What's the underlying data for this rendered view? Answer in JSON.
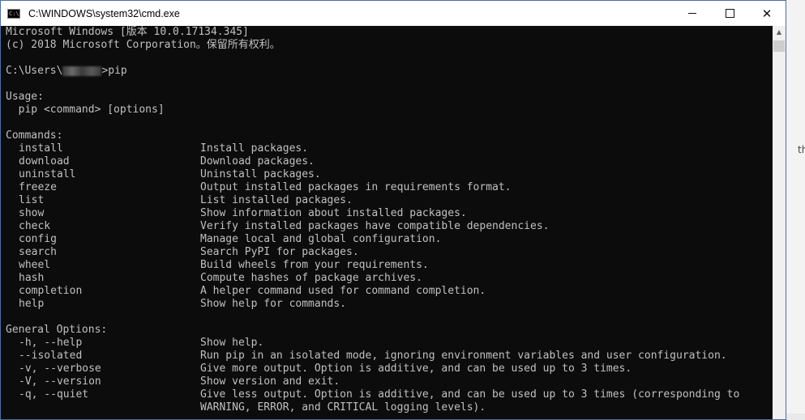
{
  "window": {
    "title": "C:\\WINDOWS\\system32\\cmd.exe",
    "icon_label": "C:\\",
    "minimize_icon": "minimize-icon",
    "maximize_icon": "maximize-icon",
    "close_glyph": "✕"
  },
  "console": {
    "banner": [
      "Microsoft Windows [版本 10.0.17134.345]",
      "(c) 2018 Microsoft Corporation。保留所有权利。"
    ],
    "prompt_prefix": "C:\\Users\\",
    "prompt_suffix": ">pip",
    "usage_header": "Usage:",
    "usage_line": "  pip <command> [options]",
    "commands_header": "Commands:",
    "commands": [
      {
        "name": "install",
        "desc": "Install packages."
      },
      {
        "name": "download",
        "desc": "Download packages."
      },
      {
        "name": "uninstall",
        "desc": "Uninstall packages."
      },
      {
        "name": "freeze",
        "desc": "Output installed packages in requirements format."
      },
      {
        "name": "list",
        "desc": "List installed packages."
      },
      {
        "name": "show",
        "desc": "Show information about installed packages."
      },
      {
        "name": "check",
        "desc": "Verify installed packages have compatible dependencies."
      },
      {
        "name": "config",
        "desc": "Manage local and global configuration."
      },
      {
        "name": "search",
        "desc": "Search PyPI for packages."
      },
      {
        "name": "wheel",
        "desc": "Build wheels from your requirements."
      },
      {
        "name": "hash",
        "desc": "Compute hashes of package archives."
      },
      {
        "name": "completion",
        "desc": "A helper command used for command completion."
      },
      {
        "name": "help",
        "desc": "Show help for commands."
      }
    ],
    "options_header": "General Options:",
    "options": [
      {
        "name": "-h, --help",
        "desc": "Show help."
      },
      {
        "name": "--isolated",
        "desc": "Run pip in an isolated mode, ignoring environment variables and user configuration."
      },
      {
        "name": "-v, --verbose",
        "desc": "Give more output. Option is additive, and can be used up to 3 times."
      },
      {
        "name": "-V, --version",
        "desc": "Show version and exit."
      },
      {
        "name": "-q, --quiet",
        "desc": "Give less output. Option is additive, and can be used up to 3 times (corresponding to"
      },
      {
        "name": "",
        "desc": "WARNING, ERROR, and CRITICAL logging levels)."
      }
    ]
  },
  "colors": {
    "console_bg": "#0c0c0c",
    "console_fg": "#c0c0c0",
    "titlebar_bg": "#ffffff"
  }
}
